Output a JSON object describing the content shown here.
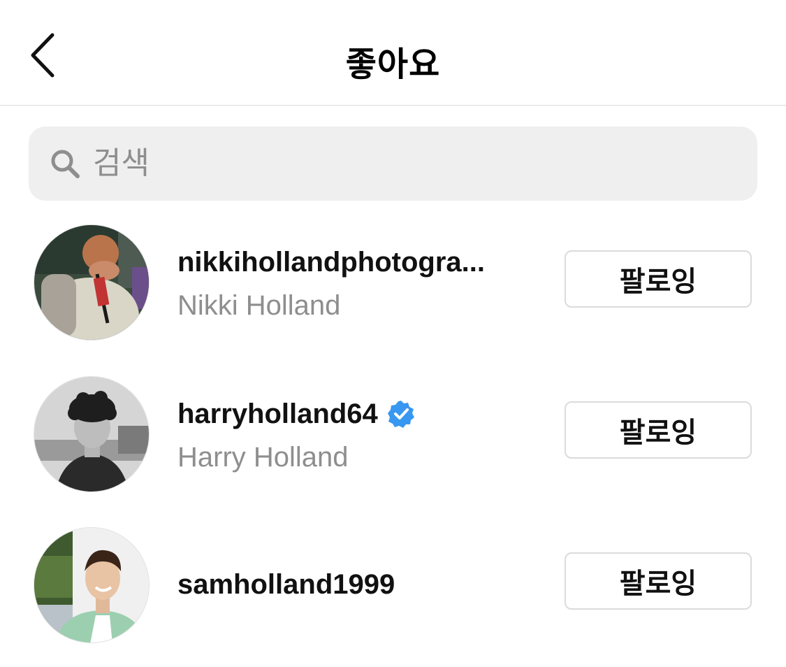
{
  "header": {
    "title": "좋아요",
    "back_icon": "chevron-left-icon"
  },
  "search": {
    "placeholder": "검색",
    "icon": "search-icon",
    "background_color": "#efefef"
  },
  "users": [
    {
      "username": "nikkihollandphotogra...",
      "full_name": "Nikki Holland",
      "verified": false,
      "button_label": "팔로잉"
    },
    {
      "username": "harryholland64",
      "full_name": "Harry Holland",
      "verified": true,
      "button_label": "팔로잉"
    },
    {
      "username": "samholland1999",
      "full_name": "",
      "verified": false,
      "button_label": "팔로잉"
    }
  ],
  "colors": {
    "verified_badge": "#3897f0",
    "secondary_text": "#8e8e8e",
    "border": "#dbdbdb"
  }
}
